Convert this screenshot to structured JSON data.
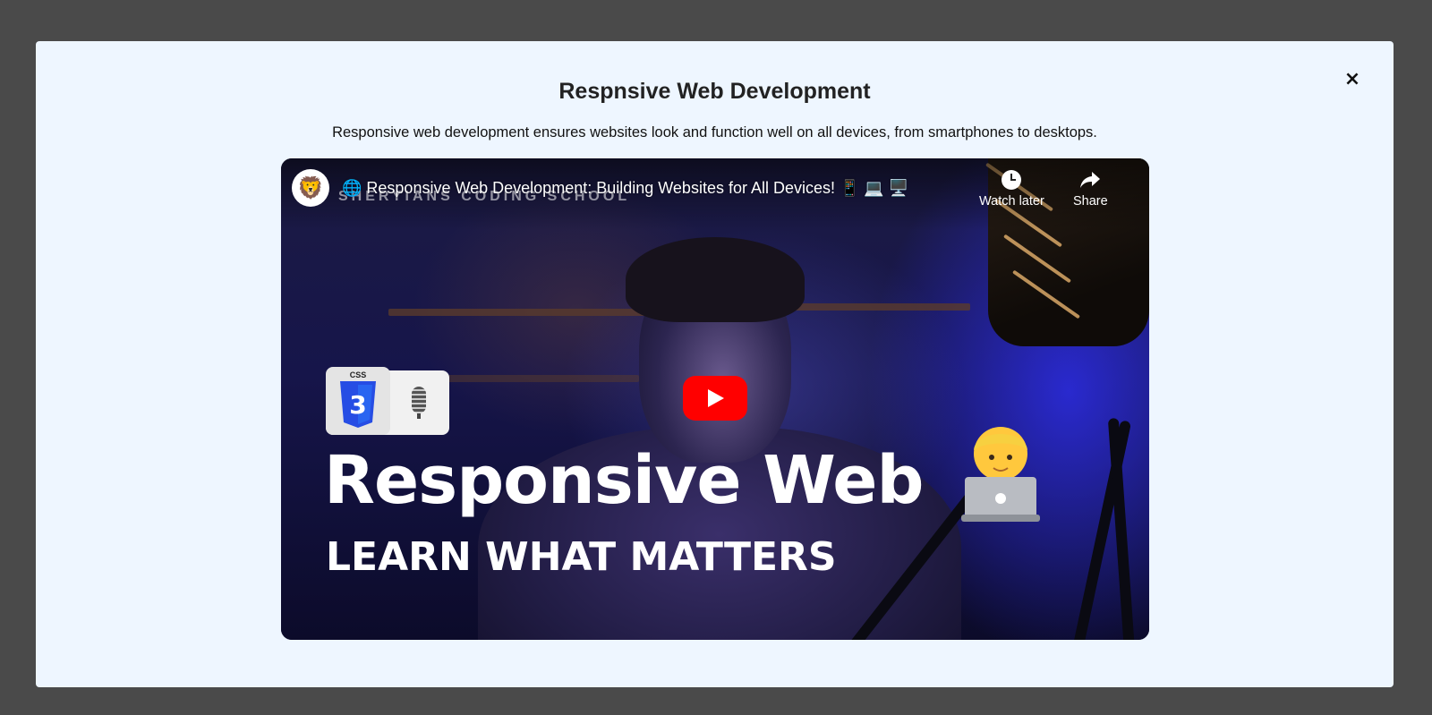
{
  "modal": {
    "title": "Respnsive Web Development",
    "description": "Responsive web development ensures websites look and function well on all devices, from smartphones to desktops.",
    "close_label": "×"
  },
  "video": {
    "title": "🌐 Responsive Web Development: Building Websites for All Devices! 📱 💻 🖥️",
    "channel_watermark": "SHERYIANS CODING SCHOOL",
    "channel_avatar_emoji": "🦁",
    "actions": {
      "watch_later": "Watch later",
      "share": "Share"
    },
    "thumbnail": {
      "badge_label": "CSS",
      "badge_number": "3",
      "headline": "Responsive Web",
      "subline": "LEARN WHAT MATTERS"
    }
  },
  "colors": {
    "backdrop": "#4a4a4a",
    "modal_bg": "#eef6ff",
    "play_button": "#ff0000",
    "css_shield": "#264de4"
  },
  "icons": [
    "close-icon",
    "channel-avatar",
    "clock-icon",
    "share-arrow-icon",
    "play-icon",
    "css3-icon",
    "microphone-icon",
    "developer-emoji"
  ]
}
